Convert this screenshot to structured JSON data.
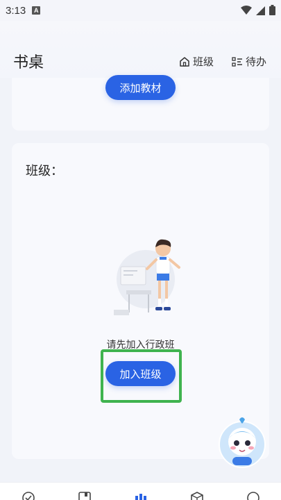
{
  "status_bar": {
    "time": "3:13",
    "notification_badge": "A",
    "icons": [
      "wifi-icon",
      "signal-icon",
      "battery-icon"
    ]
  },
  "header": {
    "title": "书桌",
    "class_button_label": "班级",
    "todo_button_label": "待办"
  },
  "top_card": {
    "add_material_label": "添加教材"
  },
  "class_card": {
    "label": "班级：",
    "empty_tip": "请先加入行政班",
    "join_button_label": "加入班级"
  },
  "colors": {
    "primary": "#2a63e4",
    "highlight": "#3fb34f",
    "background": "#f1f3f9"
  },
  "bottom_nav": {
    "icons": [
      "check-circle-icon",
      "book-icon",
      "chart-bars-icon",
      "cube-icon",
      "circle-icon"
    ]
  }
}
